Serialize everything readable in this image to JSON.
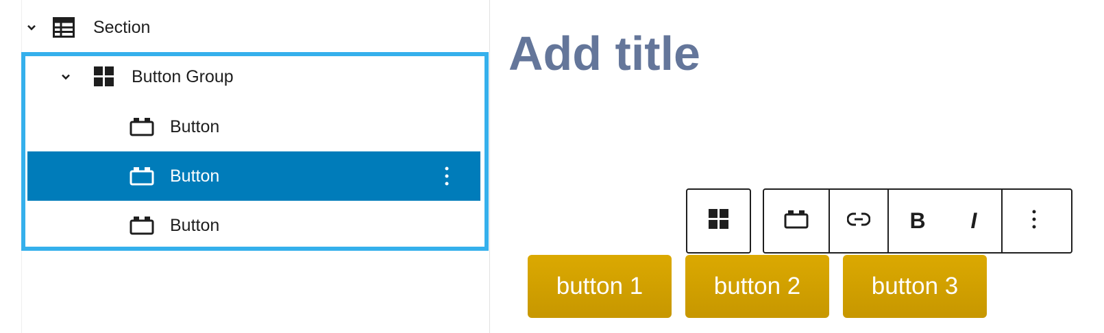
{
  "list_view": {
    "section": {
      "label": "Section",
      "icon": "table-icon"
    },
    "button_group": {
      "label": "Button Group",
      "icon": "grid-icon"
    },
    "buttons": [
      {
        "label": "Button",
        "icon": "button-icon",
        "selected": false
      },
      {
        "label": "Button",
        "icon": "button-icon",
        "selected": true
      },
      {
        "label": "Button",
        "icon": "button-icon",
        "selected": false
      }
    ],
    "selection_color": "#007cba",
    "group_outline_color": "#35b0ec"
  },
  "editor": {
    "title_placeholder": "Add title",
    "title_color": "#64769a",
    "toolbar": {
      "parent_icon": "grid-icon",
      "block_icon": "button-icon",
      "link_icon": "link-icon",
      "bold_label": "B",
      "italic_label": "I",
      "options_icon": "more-vertical-icon"
    },
    "buttons": [
      {
        "label": "button 1"
      },
      {
        "label": "button 2"
      },
      {
        "label": "button 3"
      }
    ],
    "button_color": "#d4a300"
  }
}
